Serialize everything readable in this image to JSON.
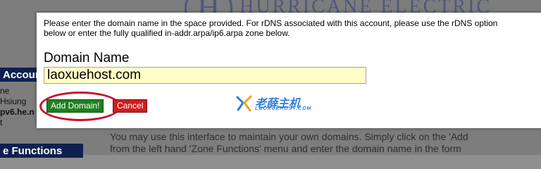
{
  "background": {
    "logo_letter": "H",
    "logo_text": "HURRICANE ELECTRIC",
    "account_box": "Account M",
    "side_lines": [
      "ne",
      "Hsiung",
      "pv6.he.n",
      "t"
    ],
    "functions_box": "e Functions",
    "main_text_line1": "You may use this interface to maintain your own domains. Simply click on the 'Add",
    "main_text_line2": "from the left hand 'Zone Functions' menu and enter the domain name in the form"
  },
  "dialog": {
    "instructions": "Please enter the domain name in the space provided. For rDNS associated with this account, please use the rDNS option\nbelow or enter the fully qualified in-addr.arpa/ip6.arpa zone below.",
    "domain_label": "Domain Name",
    "domain_value": "laoxuehost.com",
    "add_label": "Add Domain!",
    "cancel_label": "Cancel"
  },
  "watermark": {
    "title": "老薛主机",
    "subtitle": "LAOXUEHOST.COM"
  },
  "colors": {
    "add_button": "#1f7f1f",
    "cancel_button": "#cc1f1f",
    "highlight": "#c8102e",
    "input_bg": "#ffffc8"
  }
}
